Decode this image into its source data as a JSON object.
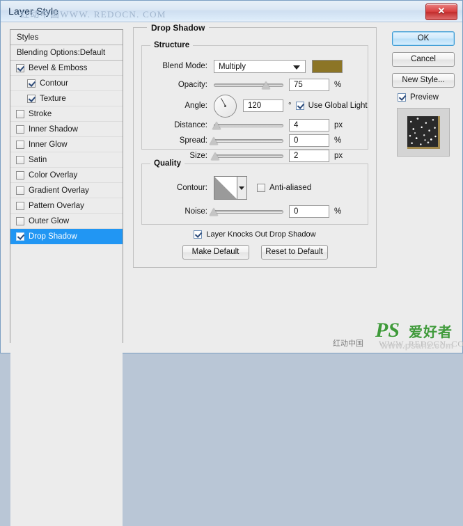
{
  "window": {
    "title": "Layer Style",
    "close_label": "✕"
  },
  "watermarks": {
    "title_overlay": "红动中国WWW. REDOCN. COM",
    "bottom_cn": "红动中国",
    "bottom_redocn": "WWW. REDOCN. COM",
    "ps_logo": "PS",
    "ps_cn": "爱好者",
    "ps_url": "www.psahz.com"
  },
  "styles_panel": {
    "header": "Styles",
    "blending_options": "Blending Options:Default",
    "items": [
      {
        "label": "Bevel & Emboss",
        "checked": true,
        "indent": false,
        "selected": false
      },
      {
        "label": "Contour",
        "checked": true,
        "indent": true,
        "selected": false
      },
      {
        "label": "Texture",
        "checked": true,
        "indent": true,
        "selected": false
      },
      {
        "label": "Stroke",
        "checked": false,
        "indent": false,
        "selected": false
      },
      {
        "label": "Inner Shadow",
        "checked": false,
        "indent": false,
        "selected": false
      },
      {
        "label": "Inner Glow",
        "checked": false,
        "indent": false,
        "selected": false
      },
      {
        "label": "Satin",
        "checked": false,
        "indent": false,
        "selected": false
      },
      {
        "label": "Color Overlay",
        "checked": false,
        "indent": false,
        "selected": false
      },
      {
        "label": "Gradient Overlay",
        "checked": false,
        "indent": false,
        "selected": false
      },
      {
        "label": "Pattern Overlay",
        "checked": false,
        "indent": false,
        "selected": false
      },
      {
        "label": "Outer Glow",
        "checked": false,
        "indent": false,
        "selected": false
      },
      {
        "label": "Drop Shadow",
        "checked": true,
        "indent": false,
        "selected": true
      }
    ]
  },
  "buttons": {
    "ok": "OK",
    "cancel": "Cancel",
    "new_style": "New Style...",
    "preview": "Preview",
    "preview_checked": true,
    "make_default": "Make Default",
    "reset_to_default": "Reset to Default"
  },
  "panel": {
    "title": "Drop Shadow",
    "structure": {
      "title": "Structure",
      "blend_mode_label": "Blend Mode:",
      "blend_mode_value": "Multiply",
      "shadow_color": "#8c7526",
      "opacity_label": "Opacity:",
      "opacity_value": "75",
      "opacity_unit": "%",
      "opacity_percent": 75,
      "angle_label": "Angle:",
      "angle_value": "120",
      "angle_unit": "°",
      "angle_degrees": 120,
      "use_global_light_label": "Use Global Light",
      "use_global_light_checked": true,
      "distance_label": "Distance:",
      "distance_value": "4",
      "distance_unit": "px",
      "distance_percent": 4,
      "spread_label": "Spread:",
      "spread_value": "0",
      "spread_unit": "%",
      "spread_percent": 0,
      "size_label": "Size:",
      "size_value": "2",
      "size_unit": "px",
      "size_percent": 2
    },
    "quality": {
      "title": "Quality",
      "contour_label": "Contour:",
      "anti_aliased_label": "Anti-aliased",
      "anti_aliased_checked": false,
      "noise_label": "Noise:",
      "noise_value": "0",
      "noise_unit": "%",
      "noise_percent": 0
    },
    "knockout_label": "Layer Knocks Out Drop Shadow",
    "knockout_checked": true
  },
  "colors": {
    "dialog_bg": "#ececec",
    "title_bar": "#dbe7f4",
    "selection_blue": "#2196f3",
    "close_red": "#c12c2c",
    "shadow_swatch": "#8c7526"
  }
}
